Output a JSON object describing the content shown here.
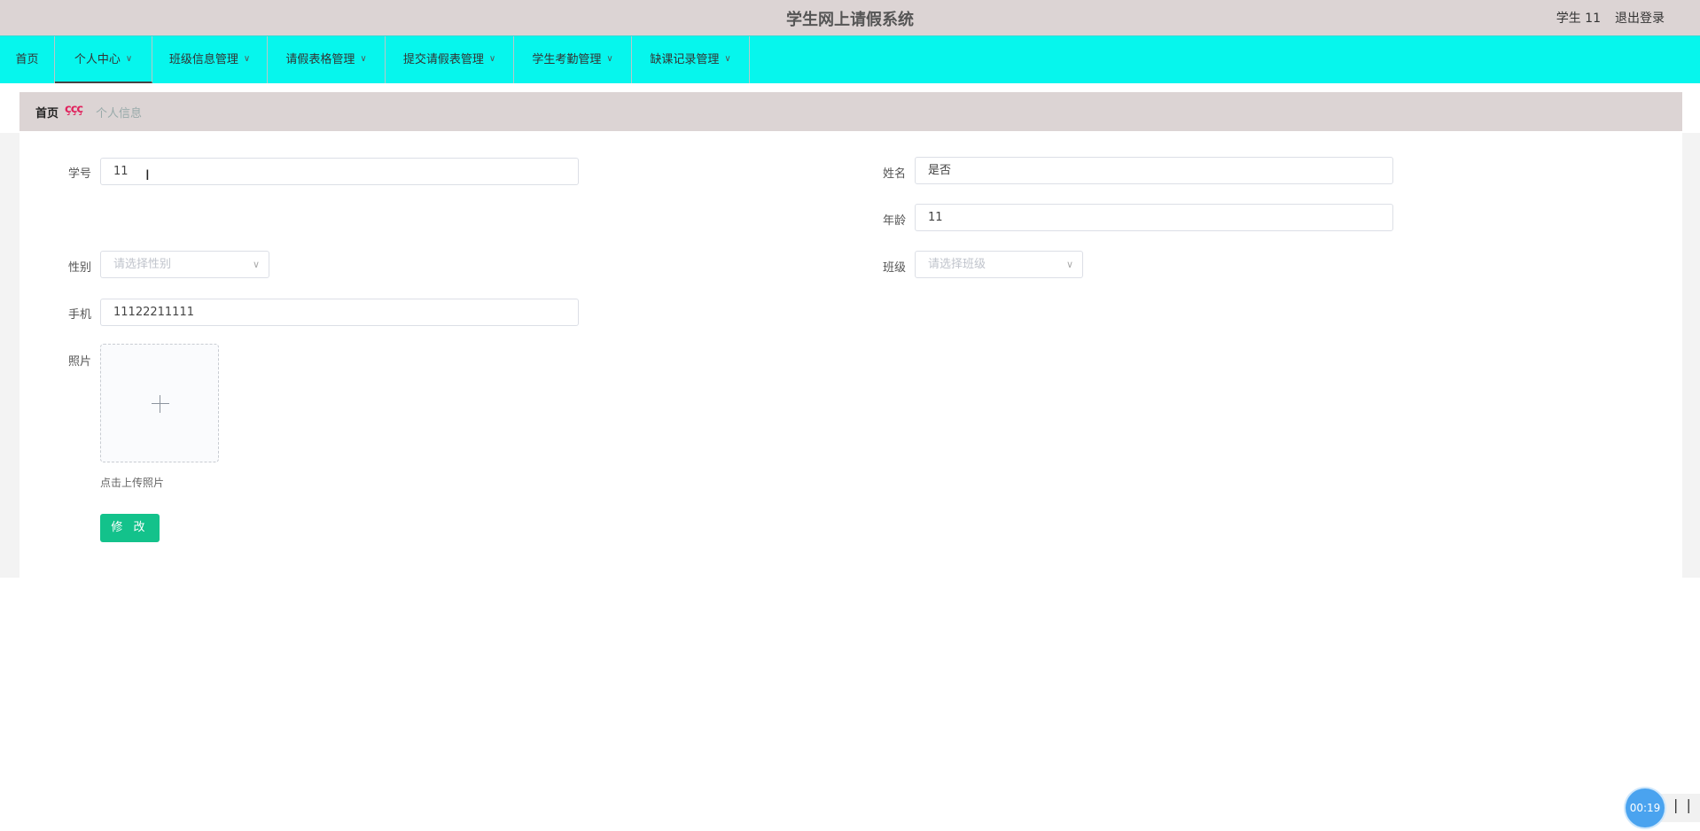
{
  "header": {
    "title": "学生网上请假系统",
    "user": "学生 11",
    "logout": "退出登录"
  },
  "nav": {
    "items": [
      {
        "label": "首页",
        "dropdown": false
      },
      {
        "label": "个人中心",
        "dropdown": true,
        "active": true
      },
      {
        "label": "班级信息管理",
        "dropdown": true
      },
      {
        "label": "请假表格管理",
        "dropdown": true
      },
      {
        "label": "提交请假表管理",
        "dropdown": true
      },
      {
        "label": "学生考勤管理",
        "dropdown": true
      },
      {
        "label": "缺课记录管理",
        "dropdown": true
      }
    ]
  },
  "breadcrumb": {
    "home": "首页",
    "separator": "ççç",
    "current": "个人信息"
  },
  "form": {
    "student_id": {
      "label": "学号",
      "value": "11"
    },
    "name": {
      "label": "姓名",
      "value": "是否"
    },
    "age": {
      "label": "年龄",
      "value": "11"
    },
    "gender": {
      "label": "性别",
      "placeholder": "请选择性别"
    },
    "class": {
      "label": "班级",
      "placeholder": "请选择班级"
    },
    "phone": {
      "label": "手机",
      "value": "11122211111"
    },
    "photo": {
      "label": "照片",
      "tip": "点击上传照片"
    },
    "submit": "修 改"
  },
  "recorder": {
    "time": "00:19",
    "pause_icon": "pause-icon"
  },
  "colors": {
    "nav_bg": "#06f6ed",
    "header_bg": "#dcd4d4",
    "button": "#13c28b"
  }
}
